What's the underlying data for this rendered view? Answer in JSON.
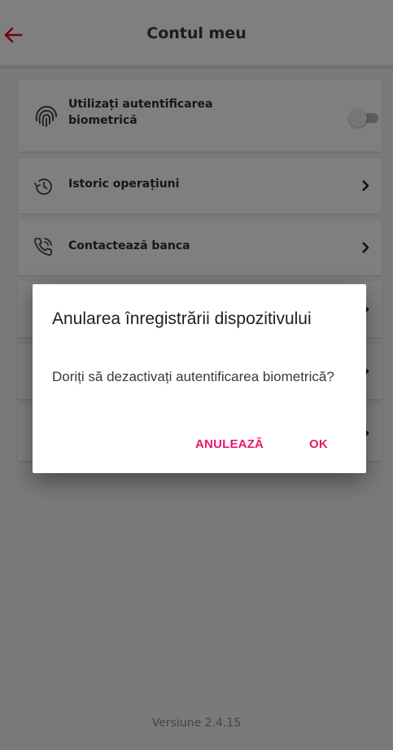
{
  "header": {
    "title": "Contul meu",
    "back_icon": "arrow-left-icon",
    "accent": "#e30613"
  },
  "settings": {
    "biometric": {
      "label": "Utilizați autentificarea biometrică",
      "icon": "fingerprint-icon",
      "enabled": false
    },
    "history": {
      "label": "Istoric operațiuni",
      "icon": "history-icon"
    },
    "contact": {
      "label": "Contactează banca",
      "icon": "phone-call-icon"
    }
  },
  "footer": {
    "version": "Versiune 2.4.15"
  },
  "dialog": {
    "title": "Anularea înregistrării dispozitivului",
    "message": "Doriți să dezactivați autentificarea biometrică?",
    "cancel_label": "ANULEAZĂ",
    "ok_label": "OK",
    "button_color": "#e8196d"
  }
}
